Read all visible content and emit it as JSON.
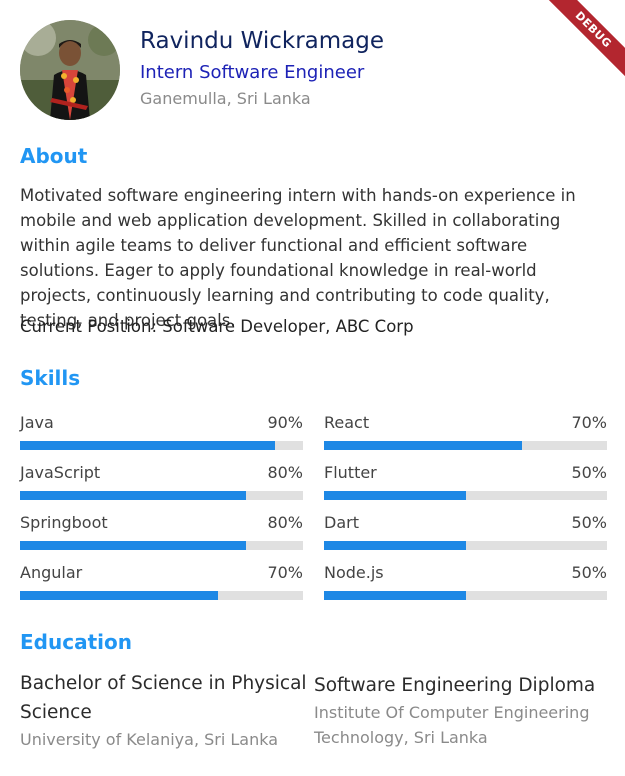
{
  "debug_banner": "DEBUG",
  "profile": {
    "name": "Ravindu Wickramage",
    "title": "Intern Software Engineer",
    "location": "Ganemulla, Sri Lanka"
  },
  "about": {
    "heading": "About",
    "text": "Motivated software engineering intern with hands-on experience in mobile and web application development. Skilled in collaborating within agile teams to deliver functional and efficient software solutions. Eager to apply foundational knowledge in real-world projects, continuously learning and contributing to code quality, testing, and project goals.",
    "current_position": "Current Position: Software Developer, ABC Corp"
  },
  "skills": {
    "heading": "Skills",
    "items": [
      {
        "name": "Java",
        "percent_label": "90%",
        "level": 0.9
      },
      {
        "name": "React",
        "percent_label": "70%",
        "level": 0.7
      },
      {
        "name": "JavaScript",
        "percent_label": "80%",
        "level": 0.8
      },
      {
        "name": "Flutter",
        "percent_label": "50%",
        "level": 0.5
      },
      {
        "name": "Springboot",
        "percent_label": "80%",
        "level": 0.8
      },
      {
        "name": "Dart",
        "percent_label": "50%",
        "level": 0.5
      },
      {
        "name": "Angular",
        "percent_label": "70%",
        "level": 0.7
      },
      {
        "name": "Node.js",
        "percent_label": "50%",
        "level": 0.5
      }
    ]
  },
  "education": {
    "heading": "Education",
    "items": [
      {
        "degree": "Bachelor of Science in Physical Science",
        "school": "University of Kelaniya, Sri Lanka"
      },
      {
        "degree": "Software Engineering Diploma",
        "school": "Institute Of Computer Engineering Technology, Sri Lanka"
      }
    ]
  },
  "colors": {
    "accent": "#2196f3",
    "name": "#10245e",
    "title": "#1d22b6",
    "bar_fill": "#1e88e5",
    "bar_track": "#e0e0e0"
  }
}
